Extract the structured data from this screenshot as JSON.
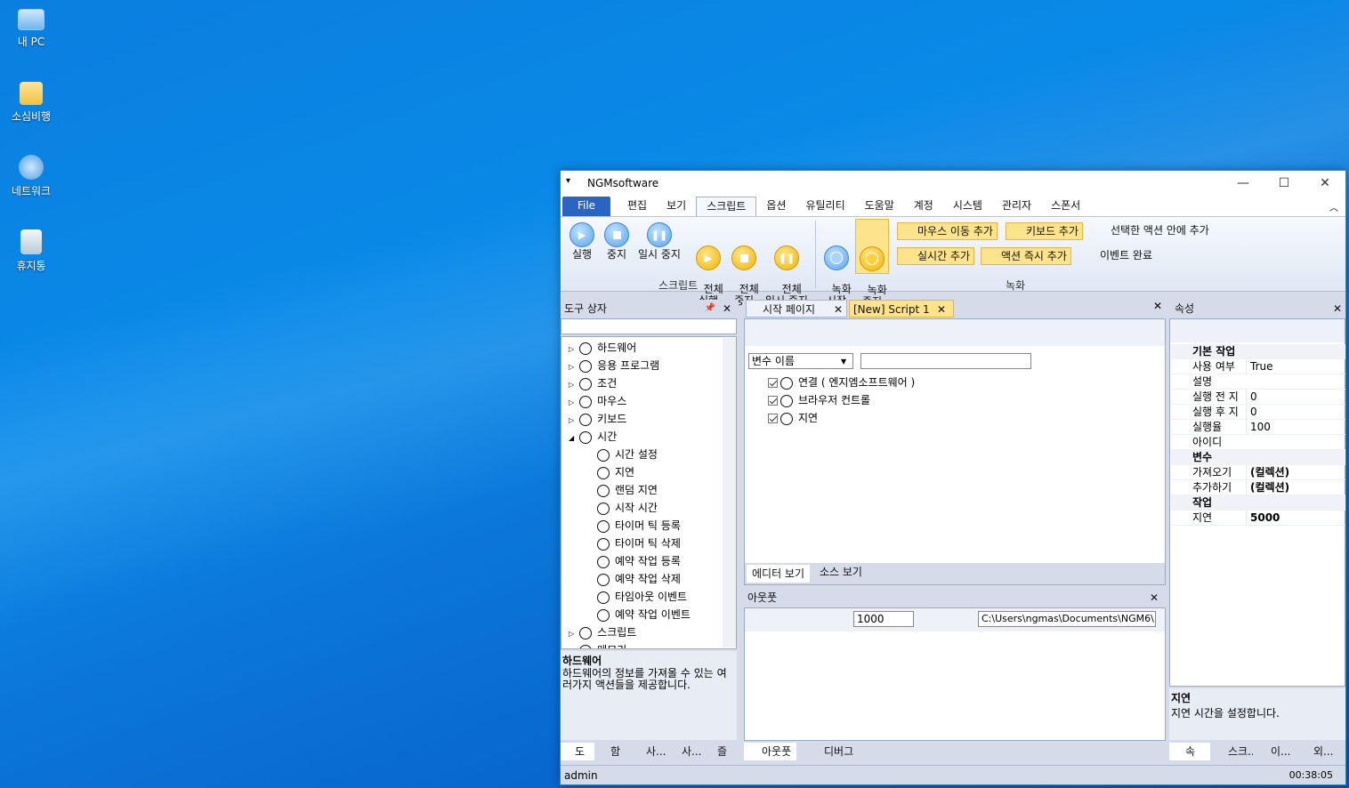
{
  "desktop": {
    "icons": [
      {
        "label": "내 PC"
      },
      {
        "label": "소심비행"
      },
      {
        "label": "네트워크"
      },
      {
        "label": "휴지통"
      }
    ]
  },
  "window": {
    "title": "NGMsoftware"
  },
  "menu": {
    "items": [
      "File",
      "편집",
      "보기",
      "스크립트",
      "옵션",
      "유틸리티",
      "도움말",
      "계정",
      "시스템",
      "관리자",
      "스폰서"
    ]
  },
  "ribbon": {
    "script_buttons": [
      {
        "label": "실행"
      },
      {
        "label": "중지"
      },
      {
        "label": "일시 중지"
      },
      {
        "label": "전체\n실행"
      },
      {
        "label": "전체\n중지"
      },
      {
        "label": "전체\n일시 중지"
      }
    ],
    "script_group": "스크립트",
    "record_buttons": [
      {
        "label": "녹화\n시작"
      },
      {
        "label": "녹화\n중지"
      }
    ],
    "record_small": [
      "마우스 이동 추가",
      "키보드 추가",
      "선택한 액션 안에 추가",
      "실시간 추가",
      "액션 즉시 추가",
      "이벤트 완료"
    ],
    "record_group": "녹화"
  },
  "toolbox": {
    "title": "도구 상자",
    "items": [
      {
        "label": "하드웨어",
        "level": 0,
        "exp": "▷"
      },
      {
        "label": "응용 프로그램",
        "level": 0,
        "exp": "▷"
      },
      {
        "label": "조건",
        "level": 0,
        "exp": "▷"
      },
      {
        "label": "마우스",
        "level": 0,
        "exp": "▷"
      },
      {
        "label": "키보드",
        "level": 0,
        "exp": "▷"
      },
      {
        "label": "시간",
        "level": 0,
        "exp": "◢"
      },
      {
        "label": "시간 설정",
        "level": 1
      },
      {
        "label": "지연",
        "level": 1
      },
      {
        "label": "랜덤 지연",
        "level": 1
      },
      {
        "label": "시작 시간",
        "level": 1
      },
      {
        "label": "타이머 틱 등록",
        "level": 1
      },
      {
        "label": "타이머 틱 삭제",
        "level": 1
      },
      {
        "label": "예약 작업 등록",
        "level": 1
      },
      {
        "label": "예약 작업 삭제",
        "level": 1
      },
      {
        "label": "타임아웃 이벤트",
        "level": 1
      },
      {
        "label": "예약 작업 이벤트",
        "level": 1
      },
      {
        "label": "스크립트",
        "level": 0,
        "exp": "▷"
      },
      {
        "label": "메모리",
        "level": 0,
        "exp": "▷"
      }
    ],
    "desc_title": "하드웨어",
    "desc_text": "하드웨어의 정보를 가져올 수 있는 여러가지 액션들을 제공합니다.",
    "bottom_tabs": [
      "도",
      "함",
      "사...",
      "사...",
      "즐"
    ]
  },
  "editor": {
    "tabs": [
      {
        "label": "시작 페이지"
      },
      {
        "label": "[New] Script 1"
      }
    ],
    "var_combo": "변수 이름",
    "actions": [
      {
        "label": "연결 ( 엔지엠소프트웨어 )"
      },
      {
        "label": "브라우저 컨트롤"
      },
      {
        "label": "지연"
      }
    ],
    "view_tabs": [
      "에디터 보기",
      "소스 보기"
    ]
  },
  "output": {
    "title": "아웃풋",
    "count": "1000",
    "path": "C:\\Users\\ngmas\\Documents\\NGM6\\",
    "tabs": [
      "아웃풋",
      "디버그"
    ]
  },
  "properties": {
    "title": "속성",
    "cats": [
      {
        "name": "기본 작업",
        "rows": [
          [
            "사용 여부",
            "True"
          ],
          [
            "설명",
            ""
          ],
          [
            "실행 전 지",
            "0"
          ],
          [
            "실행 후 지",
            "0"
          ],
          [
            "실행율",
            "100"
          ],
          [
            "아이디",
            ""
          ]
        ]
      },
      {
        "name": "변수",
        "rows": [
          [
            "가져오기",
            "(컬렉션)"
          ],
          [
            "추가하기",
            "(컬렉션)"
          ]
        ]
      },
      {
        "name": "작업",
        "rows": [
          [
            "지연",
            "5000"
          ]
        ]
      }
    ],
    "desc_title": "지연",
    "desc_text": "지연 시간을 설정합니다.",
    "bottom_tabs": [
      "속",
      "스크...",
      "이...",
      "외..."
    ]
  },
  "status": {
    "user": "admin",
    "time": "00:38:05"
  }
}
